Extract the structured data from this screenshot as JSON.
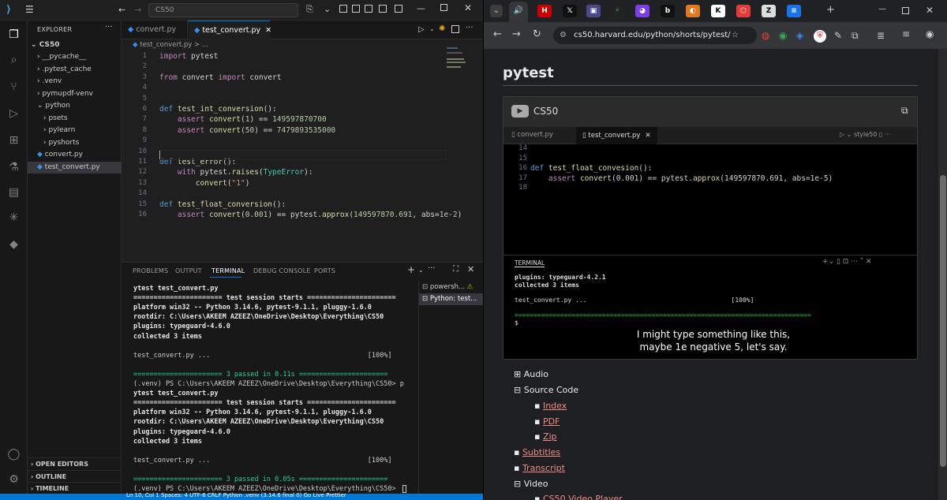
{
  "vscode": {
    "search_text": "CS50",
    "explorer_title": "EXPLORER",
    "root_folder": "CS50",
    "tree": [
      {
        "label": "__pycache__",
        "indent": 1,
        "type": "folder"
      },
      {
        "label": ".pytest_cache",
        "indent": 1,
        "type": "folder"
      },
      {
        "label": ".venv",
        "indent": 1,
        "type": "folder"
      },
      {
        "label": "pymupdf-venv",
        "indent": 1,
        "type": "folder"
      },
      {
        "label": "python",
        "indent": 1,
        "type": "folder-open"
      },
      {
        "label": "psets",
        "indent": 2,
        "type": "folder"
      },
      {
        "label": "pylearn",
        "indent": 2,
        "type": "folder"
      },
      {
        "label": "pyshorts",
        "indent": 2,
        "type": "folder"
      },
      {
        "label": "convert.py",
        "indent": 1,
        "type": "file"
      },
      {
        "label": "test_convert.py",
        "indent": 1,
        "type": "file-active"
      }
    ],
    "outline_sections": [
      "OPEN EDITORS",
      "OUTLINE",
      "TIMELINE"
    ],
    "tabs": [
      {
        "label": "convert.py",
        "active": false
      },
      {
        "label": "test_convert.py",
        "active": true
      }
    ],
    "breadcrumb": "test_convert.py > ...",
    "code_lines": [
      {
        "n": "1",
        "parts": [
          [
            "kw2",
            "import"
          ],
          [
            "t",
            " pytest"
          ]
        ]
      },
      {
        "n": "2",
        "parts": []
      },
      {
        "n": "3",
        "parts": [
          [
            "kw2",
            "from"
          ],
          [
            "t",
            " convert "
          ],
          [
            "kw2",
            "import"
          ],
          [
            "t",
            " convert"
          ]
        ]
      },
      {
        "n": "4",
        "parts": []
      },
      {
        "n": "5",
        "parts": []
      },
      {
        "n": "6",
        "parts": [
          [
            "kw",
            "def"
          ],
          [
            "t",
            " "
          ],
          [
            "fn",
            "test_int_conversion"
          ],
          [
            "t",
            "():"
          ]
        ]
      },
      {
        "n": "7",
        "parts": [
          [
            "t",
            "    "
          ],
          [
            "kw2",
            "assert"
          ],
          [
            "t",
            " "
          ],
          [
            "fn",
            "convert"
          ],
          [
            "t",
            "("
          ],
          [
            "num",
            "1"
          ],
          [
            "t",
            ") == "
          ],
          [
            "num",
            "149597870700"
          ]
        ]
      },
      {
        "n": "8",
        "parts": [
          [
            "t",
            "    "
          ],
          [
            "kw2",
            "assert"
          ],
          [
            "t",
            " "
          ],
          [
            "fn",
            "convert"
          ],
          [
            "t",
            "("
          ],
          [
            "num",
            "50"
          ],
          [
            "t",
            ") == "
          ],
          [
            "num",
            "7479893535000"
          ]
        ]
      },
      {
        "n": "9",
        "parts": []
      },
      {
        "n": "10",
        "parts": []
      },
      {
        "n": "11",
        "parts": [
          [
            "kw",
            "def"
          ],
          [
            "t",
            " "
          ],
          [
            "fn",
            "test_error"
          ],
          [
            "t",
            "():"
          ]
        ]
      },
      {
        "n": "12",
        "parts": [
          [
            "t",
            "    "
          ],
          [
            "kw2",
            "with"
          ],
          [
            "t",
            " pytest."
          ],
          [
            "fn",
            "raises"
          ],
          [
            "t",
            "("
          ],
          [
            "cls",
            "TypeError"
          ],
          [
            "t",
            "):"
          ]
        ]
      },
      {
        "n": "13",
        "parts": [
          [
            "t",
            "        "
          ],
          [
            "fn",
            "convert"
          ],
          [
            "t",
            "("
          ],
          [
            "str",
            "\"1\""
          ],
          [
            "t",
            ")"
          ]
        ]
      },
      {
        "n": "14",
        "parts": []
      },
      {
        "n": "15",
        "parts": [
          [
            "kw",
            "def"
          ],
          [
            "t",
            " "
          ],
          [
            "fn",
            "test_float_conversion"
          ],
          [
            "t",
            "():"
          ]
        ]
      },
      {
        "n": "16",
        "parts": [
          [
            "t",
            "    "
          ],
          [
            "kw2",
            "assert"
          ],
          [
            "t",
            " "
          ],
          [
            "fn",
            "convert"
          ],
          [
            "t",
            "("
          ],
          [
            "num",
            "0.001"
          ],
          [
            "t",
            ") == pytest."
          ],
          [
            "fn",
            "approx"
          ],
          [
            "t",
            "("
          ],
          [
            "num",
            "149597870.691"
          ],
          [
            "t",
            ", abs="
          ],
          [
            "num",
            "1e-2"
          ],
          [
            "t",
            ")"
          ]
        ]
      }
    ],
    "panel_tabs": [
      "PROBLEMS",
      "OUTPUT",
      "TERMINAL",
      "DEBUG CONSOLE",
      "PORTS"
    ],
    "terminal_lines": [
      {
        "t": "ytest test_convert.py",
        "c": "#e5e5e5",
        "b": true
      },
      {
        "t": "====================== test session starts ======================",
        "c": "#e5e5e5",
        "b": true
      },
      {
        "t": "platform win32 -- Python 3.14.6, pytest-9.1.1, pluggy-1.6.0",
        "c": "#e5e5e5",
        "b": true
      },
      {
        "t": "rootdir: C:\\Users\\AKEEM AZEEZ\\OneDrive\\Desktop\\Everything\\CS50",
        "c": "#e5e5e5",
        "b": true
      },
      {
        "t": "plugins: typeguard-4.6.0",
        "c": "#e5e5e5",
        "b": true
      },
      {
        "t": "collected 3 items",
        "c": "#e5e5e5",
        "b": true
      },
      {
        "t": "",
        "c": "#ccc",
        "b": false
      },
      {
        "t": "test_convert.py ...                                       [100%]",
        "c": "#ccc",
        "b": false
      },
      {
        "t": "",
        "c": "#ccc",
        "b": false
      },
      {
        "t": "====================== 3 passed in 0.11s ======================",
        "c": "#23d18b",
        "b": false
      },
      {
        "t": "(.venv) PS C:\\Users\\AKEEM AZEEZ\\OneDrive\\Desktop\\Everything\\CS50> p",
        "c": "#ccc",
        "b": false
      },
      {
        "t": "ytest test_convert.py",
        "c": "#e5e5e5",
        "b": true
      },
      {
        "t": "====================== test session starts ======================",
        "c": "#e5e5e5",
        "b": true
      },
      {
        "t": "platform win32 -- Python 3.14.6, pytest-9.1.1, pluggy-1.6.0",
        "c": "#e5e5e5",
        "b": true
      },
      {
        "t": "rootdir: C:\\Users\\AKEEM AZEEZ\\OneDrive\\Desktop\\Everything\\CS50",
        "c": "#e5e5e5",
        "b": true
      },
      {
        "t": "plugins: typeguard-4.6.0",
        "c": "#e5e5e5",
        "b": true
      },
      {
        "t": "collected 3 items",
        "c": "#e5e5e5",
        "b": true
      },
      {
        "t": "",
        "c": "#ccc",
        "b": false
      },
      {
        "t": "test_convert.py ...                                       [100%]",
        "c": "#ccc",
        "b": false
      },
      {
        "t": "",
        "c": "#ccc",
        "b": false
      },
      {
        "t": "====================== 3 passed in 0.05s ======================",
        "c": "#23d18b",
        "b": false
      },
      {
        "t": "(.venv) PS C:\\Users\\AKEEM AZEEZ\\OneDrive\\Desktop\\Everything\\CS50> ",
        "c": "#ccc",
        "b": false
      }
    ],
    "terminals": [
      {
        "label": "powersh...",
        "warn": true
      },
      {
        "label": "Python: test...",
        "warn": false
      }
    ],
    "status_text": "Ln 10, Col 1   Spaces: 4   UTF-8   CRLF   Python   .venv (3.14.6 final 0)   Go Live   Prettier"
  },
  "browser": {
    "url": "cs50.harvard.edu/python/shorts/pytest/",
    "page_title": "pytest",
    "video_channel": "CS50",
    "video_tabs": [
      "convert.py",
      "test_convert.py"
    ],
    "video_user": "style50",
    "video_code": [
      {
        "n": "14",
        "parts": []
      },
      {
        "n": "15",
        "parts": []
      },
      {
        "n": "16",
        "parts": [
          [
            "kw",
            "def"
          ],
          [
            "t",
            " "
          ],
          [
            "fn",
            "test_float_convesion"
          ],
          [
            "t",
            "():"
          ]
        ]
      },
      {
        "n": "17",
        "parts": [
          [
            "t",
            "    "
          ],
          [
            "kw2",
            "assert"
          ],
          [
            "t",
            " "
          ],
          [
            "fn",
            "convert"
          ],
          [
            "t",
            "(0.001) == pytest."
          ],
          [
            "fn",
            "approx"
          ],
          [
            "t",
            "(149597870.691, abs=1e-5)"
          ]
        ]
      },
      {
        "n": "18",
        "parts": []
      }
    ],
    "video_terminal_label": "TERMINAL",
    "video_terminal": [
      "plugins: typeguard-4.2.1",
      "collected 3 items",
      "",
      "test_convert.py ...                                      [100%]",
      "",
      "==============================================================================",
      "$ "
    ],
    "caption_line1": "I might type something like this,",
    "caption_line2": "maybe 1e negative 5, let's say.",
    "sections": [
      {
        "label": "Audio",
        "expanded": false
      },
      {
        "label": "Source Code",
        "expanded": true
      }
    ],
    "source_links": [
      "Index",
      "PDF",
      "Zip"
    ],
    "more_links": [
      "Subtitles",
      "Transcript"
    ],
    "video_section": "Video",
    "video_link": "CS50 Video Player"
  }
}
